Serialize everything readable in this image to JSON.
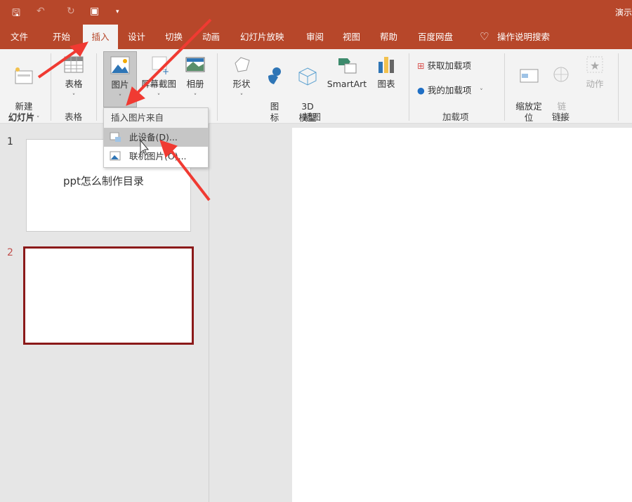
{
  "title_bar": {
    "title": "演示",
    "quick_access": [
      "save-icon",
      "undo-icon",
      "redo-icon",
      "present-icon",
      "customize-icon"
    ]
  },
  "tabs": [
    "文件",
    "开始",
    "插入",
    "设计",
    "切换",
    "动画",
    "幻灯片放映",
    "审阅",
    "视图",
    "帮助",
    "百度网盘"
  ],
  "active_tab": "插入",
  "search": "操作说明搜索",
  "ribbon": {
    "new_slide": "新建\n幻灯片",
    "table": "表格",
    "pictures": "图片",
    "screenshot": "屏幕截图",
    "album": "相册",
    "shapes": "形状",
    "icons": "图\n标",
    "model3d": "3D\n模型",
    "smartart": "SmartArt",
    "chart": "图表",
    "get_addins": "获取加载项",
    "my_addins": "我的加载项",
    "zoom": "缩放定\n位",
    "link": "链\n接",
    "action": "动作",
    "groups": {
      "slides": "幻灯片",
      "tables": "表格",
      "illustrations": "插图",
      "addins": "加载项",
      "links": "链接"
    }
  },
  "dropdown": {
    "header": "插入图片来自",
    "items": [
      "此设备(D)...",
      "联机图片(O)..."
    ]
  },
  "slides": [
    {
      "number": "1",
      "text": "ppt怎么制作目录"
    },
    {
      "number": "2",
      "text": ""
    }
  ],
  "colors": {
    "accent": "#b7472a",
    "annotation_arrow": "#f03a32",
    "selected_slide": "#8b1a1a"
  }
}
